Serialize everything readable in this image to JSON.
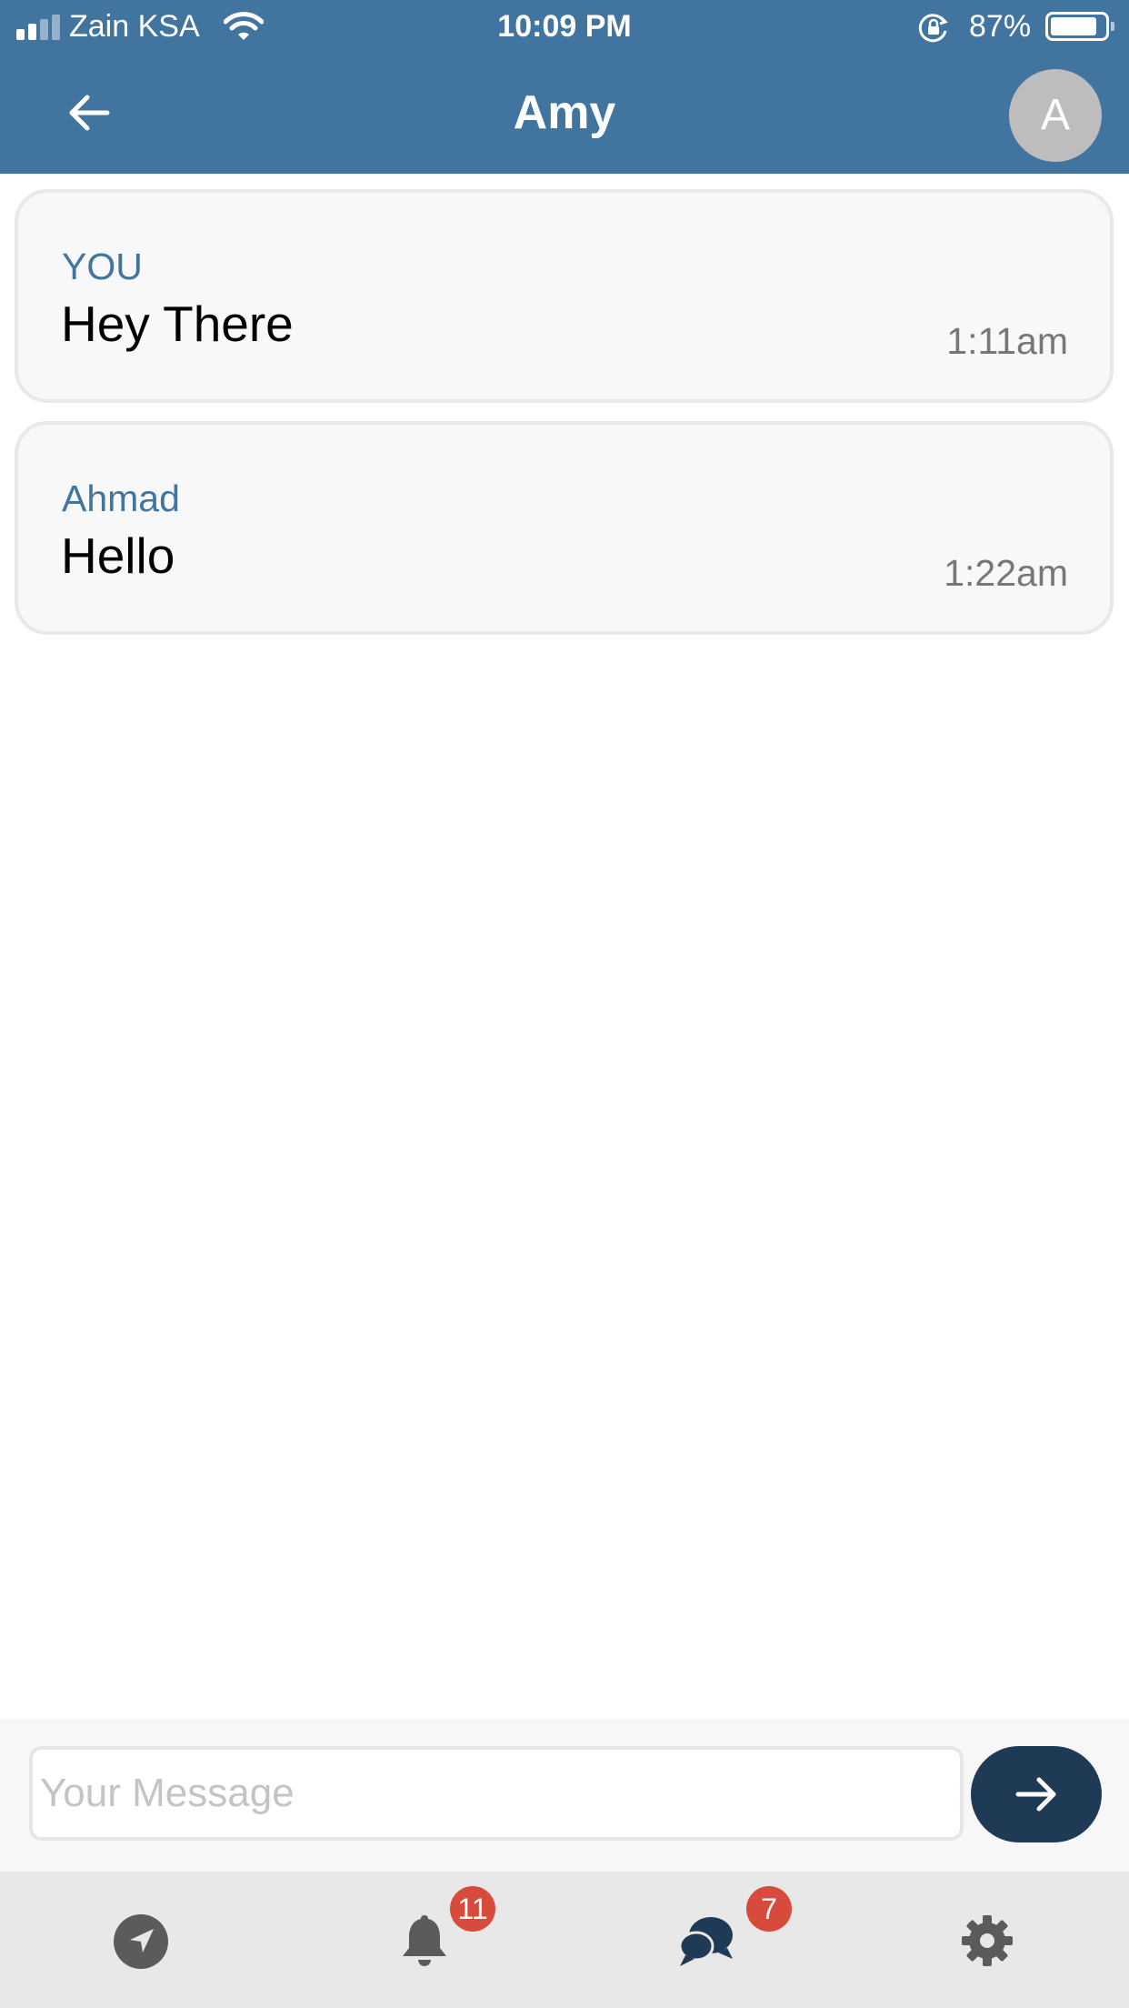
{
  "status_bar": {
    "carrier": "Zain KSA",
    "time": "10:09 PM",
    "battery": "87%",
    "battery_level": 0.87,
    "icons": [
      "signal-icon",
      "wifi-icon",
      "orientation-lock-icon",
      "battery-icon"
    ]
  },
  "header": {
    "title": "Amy",
    "avatar_initial": "A",
    "back_icon": "arrow-left-icon"
  },
  "messages": [
    {
      "sender": "YOU",
      "text": "Hey There",
      "time": "1:11am"
    },
    {
      "sender": "Ahmad",
      "text": "Hello",
      "time": "1:22am"
    }
  ],
  "composer": {
    "placeholder": "Your Message",
    "value": "",
    "send_icon": "arrow-right-icon"
  },
  "tabbar": {
    "tabs": [
      {
        "name": "location",
        "icon": "navigation-arrow-icon"
      },
      {
        "name": "notifications",
        "icon": "bell-icon",
        "badge": "11"
      },
      {
        "name": "messages",
        "icon": "chat-bubbles-icon",
        "badge": "7"
      },
      {
        "name": "settings",
        "icon": "gear-icon"
      }
    ]
  },
  "colors": {
    "header": "#41749e",
    "accent_text": "#41749e",
    "send_button": "#1e3a55",
    "badge": "#d74b3c",
    "tabbar": "#e8e8e8"
  }
}
